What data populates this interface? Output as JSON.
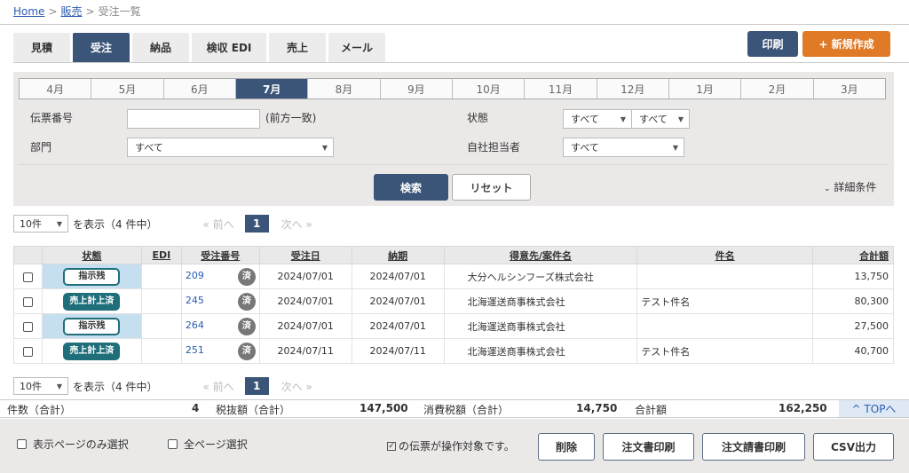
{
  "breadcrumb": {
    "home": "Home",
    "sales": "販売",
    "current": "受注一覧",
    "sep": ">"
  },
  "tabs": [
    {
      "label": "見積",
      "active": false
    },
    {
      "label": "受注",
      "active": true
    },
    {
      "label": "納品",
      "active": false
    },
    {
      "label": "検収 EDI",
      "active": false
    },
    {
      "label": "売上",
      "active": false
    },
    {
      "label": "メール",
      "active": false
    }
  ],
  "toolbar": {
    "print_label": "印刷",
    "new_label": "+ 新規作成"
  },
  "months": [
    "4月",
    "5月",
    "6月",
    "7月",
    "8月",
    "9月",
    "10月",
    "11月",
    "12月",
    "1月",
    "2月",
    "3月"
  ],
  "active_month": "7月",
  "search": {
    "slip_label": "伝票番号",
    "slip_value": "",
    "slip_hint": "(前方一致)",
    "dept_label": "部門",
    "dept_value": "すべて",
    "status_label": "状態",
    "status_value1": "すべて",
    "status_value2": "すべて",
    "staff_label": "自社担当者",
    "staff_value": "すべて",
    "search_button": "検索",
    "reset_button": "リセット",
    "detail_label": "詳細条件"
  },
  "pager": {
    "per_page": "10件",
    "count_text": "を表示（4 件中）",
    "prev": "« 前へ",
    "page": "1",
    "next": "次へ »"
  },
  "table": {
    "headers": [
      "状態",
      "EDI",
      "受注番号",
      "受注日",
      "納期",
      "得意先/案件名",
      "件名",
      "合計額"
    ],
    "rows": [
      {
        "status": "指示残",
        "status_style": "outline",
        "edi": "",
        "number": "209",
        "done": "済",
        "order_date": "2024/07/01",
        "due": "2024/07/01",
        "customer": "大分ヘルシンフーズ株式会社",
        "subject": "",
        "amount": "13,750"
      },
      {
        "status": "売上計上済",
        "status_style": "fill",
        "edi": "",
        "number": "245",
        "done": "済",
        "order_date": "2024/07/01",
        "due": "2024/07/01",
        "customer": "北海運送商事株式会社",
        "subject": "テスト件名",
        "amount": "80,300"
      },
      {
        "status": "指示残",
        "status_style": "outline",
        "edi": "",
        "number": "264",
        "done": "済",
        "order_date": "2024/07/01",
        "due": "2024/07/01",
        "customer": "北海運送商事株式会社",
        "subject": "",
        "amount": "27,500"
      },
      {
        "status": "売上計上済",
        "status_style": "fill",
        "edi": "",
        "number": "251",
        "done": "済",
        "order_date": "2024/07/11",
        "due": "2024/07/11",
        "customer": "北海運送商事株式会社",
        "subject": "テスト件名",
        "amount": "40,700"
      }
    ]
  },
  "totals": {
    "count_label": "件数（合計）",
    "count_value": "4",
    "pretax_label": "税抜額（合計）",
    "pretax_value": "147,500",
    "tax_label": "消費税額（合計）",
    "tax_value": "14,750",
    "total_label": "合計額",
    "total_value": "162,250",
    "top_link": "^ TOPへ"
  },
  "footer": {
    "page_only": "表示ページのみ選択",
    "all_pages": "全ページ選択",
    "target_text": "の伝票が操作対象です。",
    "delete": "削除",
    "order_print": "注文書印刷",
    "order_invoice_print": "注文請書印刷",
    "csv": "CSV出力"
  },
  "colors": {
    "navy": "#3a5578",
    "orange": "#e07a26",
    "teal": "#1f6f7a",
    "status_blue": "#c5dff0",
    "link": "#2a5db0"
  }
}
